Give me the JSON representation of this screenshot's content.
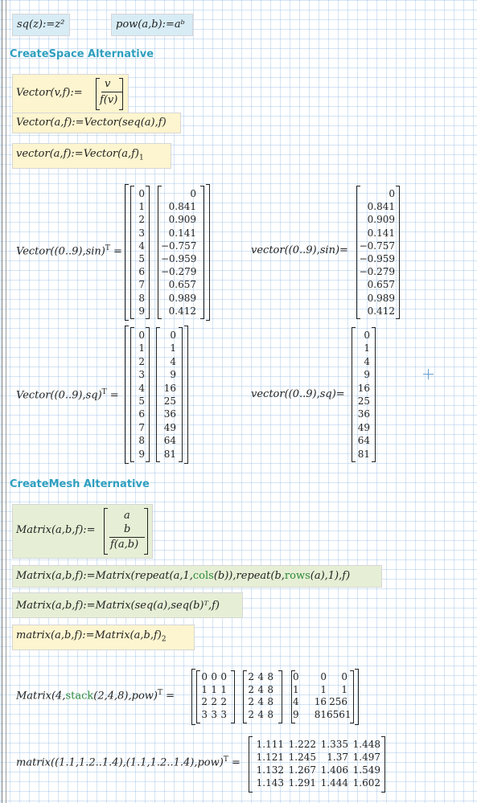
{
  "defs": {
    "sq": "sq(z):=z²",
    "pow": "pow(a,b):=aᵇ"
  },
  "sections": {
    "createspace": "CreateSpace Alternative",
    "createmesh": "CreateMesh Alternative"
  },
  "space": {
    "vector1_lhs": "Vector(v,f):=",
    "vector1_top": "v",
    "vector1_bot": "f(v)",
    "vector2": "Vector(a,f):=Vector(seq(a),f)",
    "vector3": "vector(a,f):=Vector(a,f)",
    "vector3_sub": "1",
    "eval_sin_T": "Vector((0..9),sin)",
    "eval_sin": "vector((0..9),sin)=",
    "eval_sq_T": "Vector((0..9),sq)",
    "eval_sq": "vector((0..9),sq)="
  },
  "mesh": {
    "matrix1_lhs": "Matrix(a,b,f):=",
    "matrix1_a": "a",
    "matrix1_b": "b",
    "matrix1_f": "f(a,b)",
    "matrix2": "Matrix(a,b,f):=Matrix(repeat(a,1,cols(b)),repeat(b,rows(a),1),f)",
    "matrix3": "Matrix(a,b,f):=Matrix(seq(a),seq(b)ᵀ,f)",
    "matrix4": "matrix(a,b,f):=Matrix(a,b,f)",
    "matrix4_sub": "2",
    "eval_stack": "Matrix(4,stack(2,4,8),pow)",
    "eval_matrix": "matrix((1.1,1.2..1.4),(1.1,1.2..1.4),pow)"
  },
  "results": {
    "idx": [
      "0",
      "1",
      "2",
      "3",
      "4",
      "5",
      "6",
      "7",
      "8",
      "9"
    ],
    "sin": [
      "0",
      "0.841",
      "0.909",
      "0.141",
      "−0.757",
      "−0.959",
      "−0.279",
      "0.657",
      "0.989",
      "0.412"
    ],
    "sq": [
      "0",
      "1",
      "4",
      "9",
      "16",
      "25",
      "36",
      "49",
      "64",
      "81"
    ],
    "m1": [
      [
        "0",
        "0",
        "0"
      ],
      [
        "1",
        "1",
        "1"
      ],
      [
        "2",
        "2",
        "2"
      ],
      [
        "3",
        "3",
        "3"
      ]
    ],
    "m2": [
      [
        "2",
        "4",
        "8"
      ],
      [
        "2",
        "4",
        "8"
      ],
      [
        "2",
        "4",
        "8"
      ],
      [
        "2",
        "4",
        "8"
      ]
    ],
    "m3": [
      [
        "0",
        "0",
        "0"
      ],
      [
        "1",
        "1",
        "1"
      ],
      [
        "4",
        "16",
        "256"
      ],
      [
        "9",
        "81",
        "6561"
      ]
    ],
    "m4": [
      [
        "1.111",
        "1.222",
        "1.335",
        "1.448"
      ],
      [
        "1.121",
        "1.245",
        "1.37",
        "1.497"
      ],
      [
        "1.132",
        "1.267",
        "1.406",
        "1.549"
      ],
      [
        "1.143",
        "1.291",
        "1.444",
        "1.602"
      ]
    ]
  },
  "colors": {
    "heading": "#2f9fbf",
    "function": "#2c8a3a",
    "region_blue": "#d7ecf5",
    "region_yellow": "#fdf5cf",
    "region_green": "#e6efd5"
  }
}
